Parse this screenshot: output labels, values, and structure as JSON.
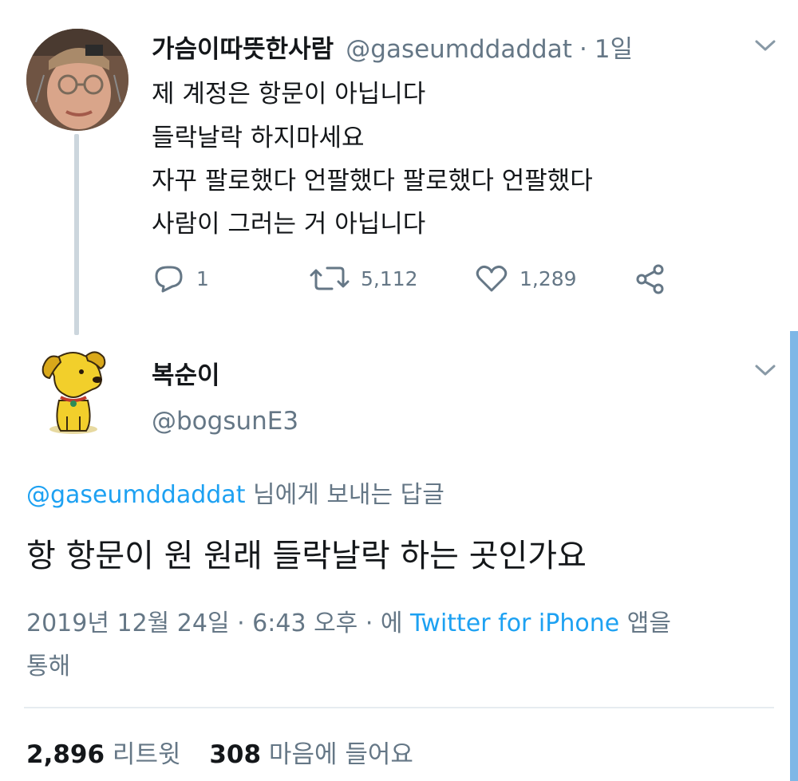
{
  "original_tweet": {
    "display_name": "가슴이따뜻한사람",
    "handle": "@gaseumddaddat",
    "separator": "·",
    "time_ago": "1일",
    "lines": [
      "제 계정은 항문이 아닙니다",
      "들락날락 하지마세요",
      "자꾸 팔로했다 언팔했다 팔로했다 언팔했다",
      "사람이 그러는 거 아닙니다"
    ],
    "reply_count": "1",
    "retweet_count": "5,112",
    "like_count": "1,289"
  },
  "reply_tweet": {
    "display_name": "복순이",
    "handle": "@bogsunE3",
    "replying_to_handle": "@gaseumddaddat",
    "replying_to_suffix": "님에게 보내는 답글",
    "text": "항 항문이 원 원래 들락날락 하는 곳인가요",
    "timestamp": "2019년 12월 24일 · 6:43 오후 · 에",
    "source": "Twitter for iPhone",
    "source_suffix_1": "앱을",
    "source_suffix_2": "통해",
    "retweets_count": "2,896",
    "retweets_label": "리트윗",
    "likes_count": "308",
    "likes_label": "마음에 들어요"
  },
  "colors": {
    "link": "#1da1f2",
    "muted": "#657786",
    "thread_line": "#ccd6dd",
    "scrollbar": "#7fb7e6"
  },
  "icons": [
    "reply-icon",
    "retweet-icon",
    "like-icon",
    "share-icon",
    "chevron-down-icon",
    "avatar-icon"
  ]
}
